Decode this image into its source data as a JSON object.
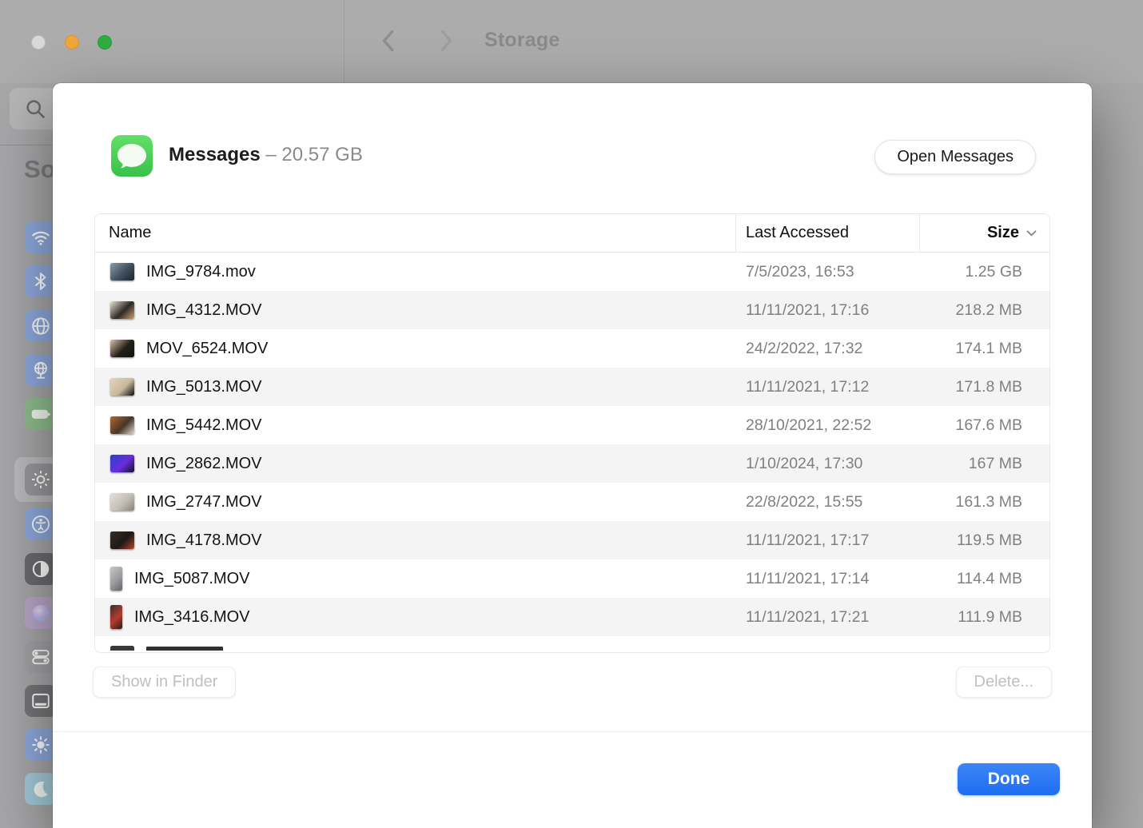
{
  "titlebar": {
    "title": "Storage",
    "traffic_lights": [
      "close",
      "minimize",
      "zoom"
    ]
  },
  "sidebar": {
    "profile_text": "So",
    "search_icon": "magnifier-icon",
    "icons": [
      {
        "name": "wifi-icon",
        "color": "#8ea9dc"
      },
      {
        "name": "bluetooth-icon",
        "color": "#8ea9dc"
      },
      {
        "name": "network-icon",
        "color": "#8ea9dc"
      },
      {
        "name": "vpn-icon",
        "color": "#8ea9dc"
      },
      {
        "name": "battery-icon",
        "color": "#8fbe8d"
      },
      {
        "name": "general-gear-icon",
        "color": "#98989b",
        "selected": true
      },
      {
        "name": "accessibility-icon",
        "color": "#8ea9dc"
      },
      {
        "name": "appearance-icon",
        "color": "#6c6c70"
      },
      {
        "name": "siri-icon",
        "color": "#b9a6c9"
      },
      {
        "name": "control-center-icon",
        "color": "#a2a2a5"
      },
      {
        "name": "desktop-dock-icon",
        "color": "#757578"
      },
      {
        "name": "displays-icon",
        "color": "#8ea9dc"
      },
      {
        "name": "screensaver-icon",
        "color": "#a3cbd8"
      }
    ]
  },
  "dialog": {
    "header": {
      "app_icon": "messages-app-icon",
      "title": "Messages",
      "size_text": " – 20.57 GB",
      "open_button_label": "Open Messages"
    },
    "table": {
      "columns": [
        {
          "label": "Name"
        },
        {
          "label": "Last Accessed"
        },
        {
          "label": "Size",
          "sorted": "desc"
        }
      ],
      "rows": [
        {
          "name": "IMG_9784.mov",
          "accessed": "7/5/2023, 16:53",
          "size": "1.25 GB",
          "orientation": "landscape",
          "thumb": [
            "#8f99a5",
            "#3f4f61",
            "#1f242b"
          ]
        },
        {
          "name": "IMG_4312.MOV",
          "accessed": "11/11/2021, 17:16",
          "size": "218.2 MB",
          "orientation": "landscape",
          "thumb": [
            "#e8e0d2",
            "#2e2924",
            "#c8a66e"
          ]
        },
        {
          "name": "MOV_6524.MOV",
          "accessed": "24/2/2022, 17:32",
          "size": "174.1 MB",
          "orientation": "landscape",
          "thumb": [
            "#d9c3a5",
            "#242019",
            "#121110"
          ]
        },
        {
          "name": "IMG_5013.MOV",
          "accessed": "11/11/2021, 17:12",
          "size": "171.8 MB",
          "orientation": "landscape",
          "thumb": [
            "#e3d4bd",
            "#c9b89e",
            "#0d0d0d"
          ]
        },
        {
          "name": "IMG_5442.MOV",
          "accessed": "28/10/2021, 22:52",
          "size": "167.6 MB",
          "orientation": "landscape",
          "thumb": [
            "#b06a32",
            "#483527",
            "#ded9d2"
          ]
        },
        {
          "name": "IMG_2862.MOV",
          "accessed": "1/10/2024, 17:30",
          "size": "167 MB",
          "orientation": "landscape",
          "thumb": [
            "#2743c8",
            "#6a2ddb",
            "#140f25"
          ]
        },
        {
          "name": "IMG_2747.MOV",
          "accessed": "22/8/2022, 15:55",
          "size": "161.3 MB",
          "orientation": "landscape",
          "thumb": [
            "#e2dfda",
            "#c4beb6",
            "#89827a"
          ]
        },
        {
          "name": "IMG_4178.MOV",
          "accessed": "11/11/2021, 17:17",
          "size": "119.5 MB",
          "orientation": "landscape",
          "thumb": [
            "#342e28",
            "#1c1916",
            "#b6452c"
          ]
        },
        {
          "name": "IMG_5087.MOV",
          "accessed": "11/11/2021, 17:14",
          "size": "114.4 MB",
          "orientation": "portrait",
          "thumb": [
            "#c6c6ca",
            "#9b9b9f",
            "#63636a"
          ]
        },
        {
          "name": "IMG_3416.MOV",
          "accessed": "11/11/2021, 17:21",
          "size": "111.9 MB",
          "orientation": "portrait",
          "thumb": [
            "#37302c",
            "#b73a2e",
            "#211d1b"
          ]
        }
      ],
      "partial_row_visible": true
    },
    "footer": {
      "show_in_finder_label": "Show in Finder",
      "delete_label": "Delete...",
      "done_label": "Done"
    }
  },
  "colors": {
    "accent_blue": "#2277f4",
    "messages_green": "#4fd455",
    "dim_background": "#a9a9a9"
  }
}
